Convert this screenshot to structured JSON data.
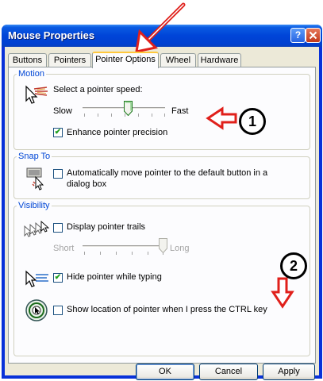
{
  "window": {
    "title": "Mouse Properties",
    "help_button": "?",
    "close_button": "x"
  },
  "tabs": [
    {
      "label": "Buttons"
    },
    {
      "label": "Pointers"
    },
    {
      "label": "Pointer Options",
      "active": true
    },
    {
      "label": "Wheel"
    },
    {
      "label": "Hardware"
    }
  ],
  "motion": {
    "legend": "Motion",
    "prompt": "Select a pointer speed:",
    "slow_label": "Slow",
    "fast_label": "Fast",
    "speed_level": 0.55,
    "enhance_label": "Enhance pointer precision",
    "enhance_checked": true
  },
  "snap_to": {
    "legend": "Snap To",
    "label_line1": "Automatically move pointer to the default button in a",
    "label_line2": "dialog box",
    "checked": false
  },
  "visibility": {
    "legend": "Visibility",
    "trails_label": "Display pointer trails",
    "trails_checked": false,
    "short_label": "Short",
    "long_label": "Long",
    "trail_length_level": 1.0,
    "hide_label": "Hide pointer while typing",
    "hide_checked": true,
    "ctrl_label": "Show location of pointer when I press the CTRL key",
    "ctrl_checked": false
  },
  "buttons": {
    "ok": "OK",
    "cancel": "Cancel",
    "apply": "Apply"
  },
  "annotations": {
    "callout_1": "1",
    "callout_2": "2",
    "arrow_color": "#e0201b"
  },
  "colors": {
    "titlebar": "#0044d8",
    "group_legend": "#0046d5",
    "tab_highlight": "#ffc83c"
  }
}
